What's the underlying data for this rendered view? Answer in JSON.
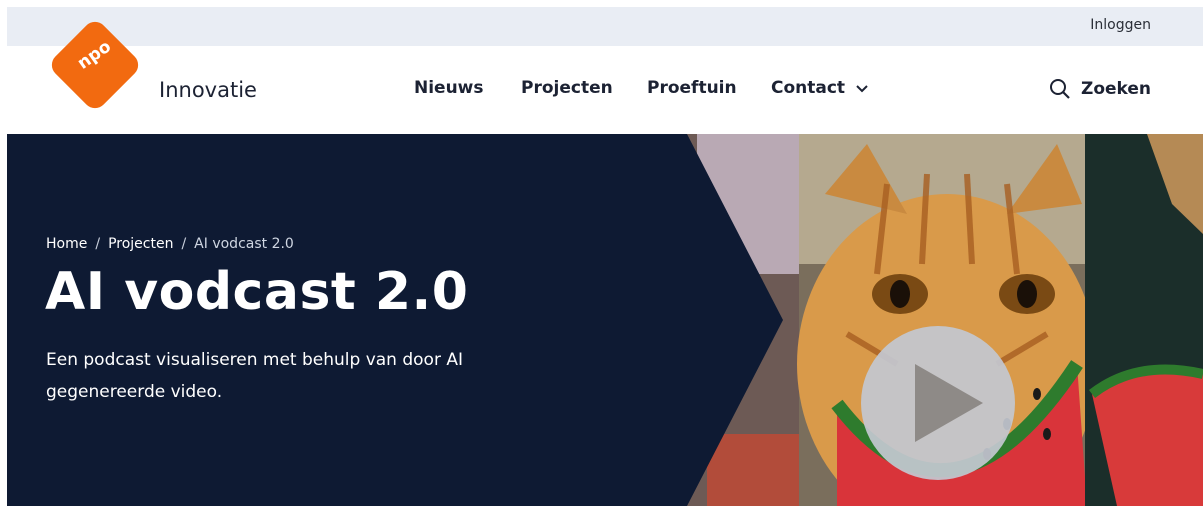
{
  "header": {
    "login_label": "Inloggen",
    "logo_text": "npo",
    "site_name": "Innovatie",
    "nav": [
      "Nieuws",
      "Projecten",
      "Proeftuin",
      "Contact"
    ],
    "search_label": "Zoeken"
  },
  "hero": {
    "breadcrumb": [
      "Home",
      "Projecten",
      "AI vodcast 2.0"
    ],
    "title": "AI vodcast 2.0",
    "subtitle": "Een podcast visualiseren met behulp van door AI gegenereerde video."
  },
  "colors": {
    "topbar": "#e9edf4",
    "hero_background": "#0e1a33",
    "logo_orange": "#f26a10",
    "text_dark": "#1c2233"
  },
  "icons": {
    "chevron": "chevron-down-icon",
    "search": "search-icon",
    "play": "play-icon"
  }
}
